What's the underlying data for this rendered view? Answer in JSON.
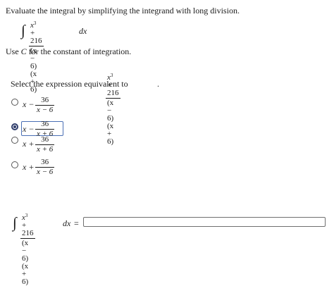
{
  "instruction": "Evaluate the integral by simplifying the integrand with long division.",
  "integral": {
    "numerator_base": "x",
    "numerator_exp": "3",
    "numerator_rest": " + 216",
    "denominator": "(x − 6)(x + 6)",
    "dx": "dx"
  },
  "constant_note_prefix": "Use ",
  "constant_symbol": "C",
  "constant_note_suffix": " for the constant of integration.",
  "question_prefix": "Select the expression equivalent to",
  "question_period": ".",
  "options": [
    {
      "lead": "x −",
      "num": "36",
      "den": "x − 6",
      "selected": false
    },
    {
      "lead": "x −",
      "num": "36",
      "den": "x + 6",
      "selected": true
    },
    {
      "lead": "x +",
      "num": "36",
      "den": "x + 6",
      "selected": false
    },
    {
      "lead": "x +",
      "num": "36",
      "den": "x − 6",
      "selected": false
    }
  ],
  "equals": "=",
  "answer_value": ""
}
